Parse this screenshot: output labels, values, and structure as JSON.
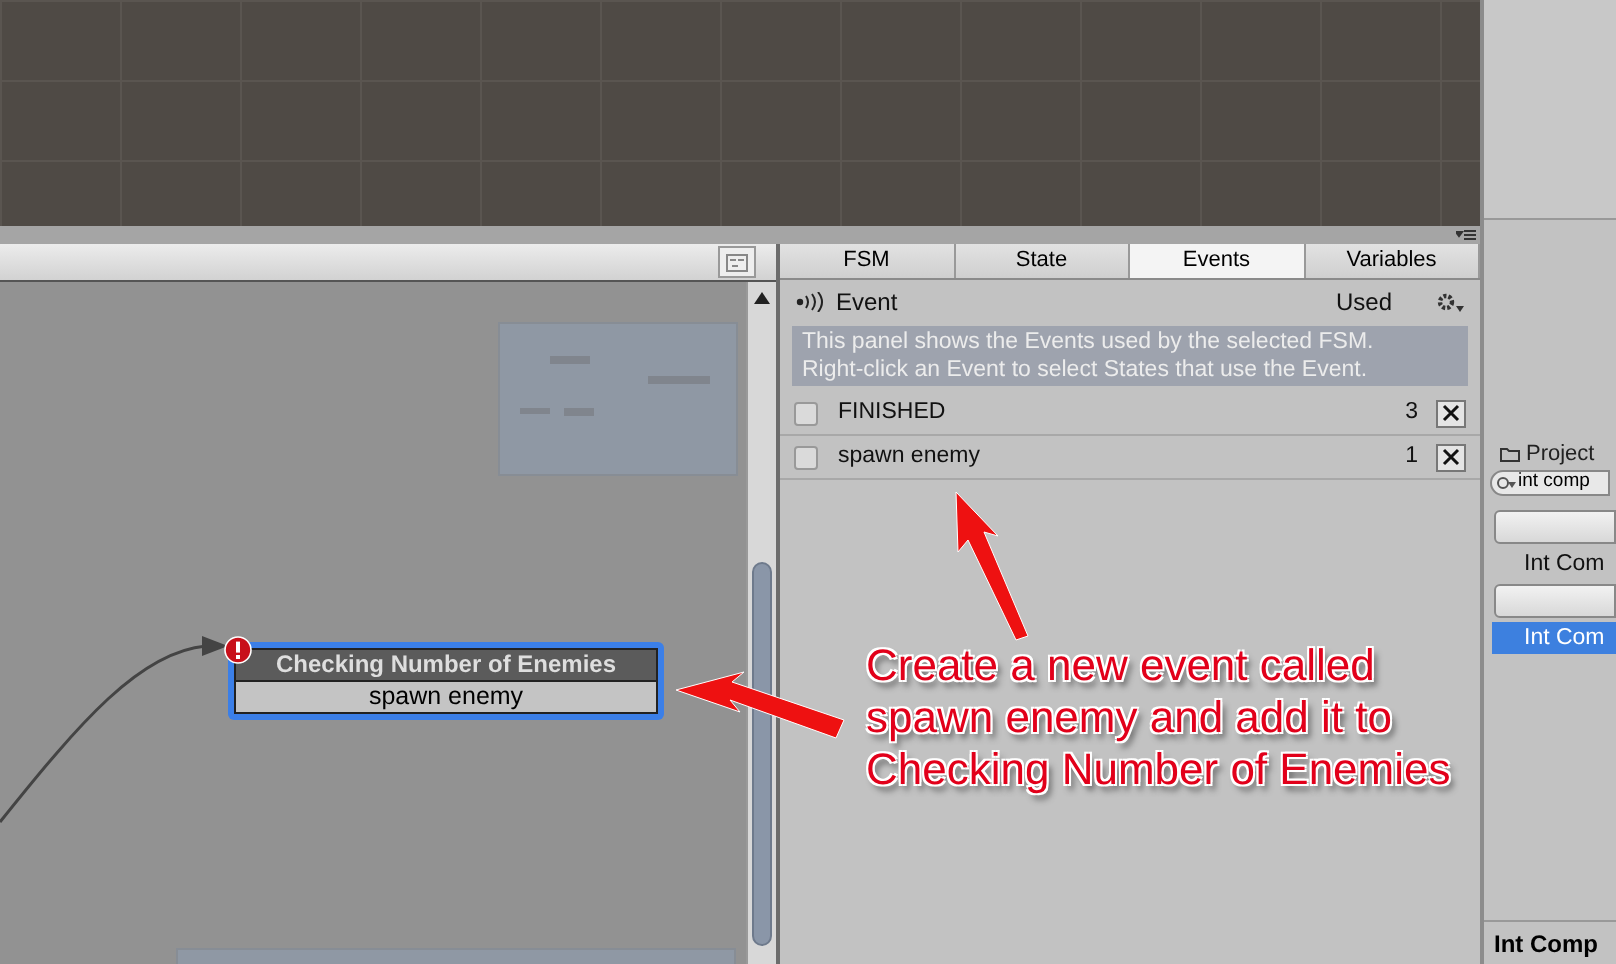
{
  "graph": {
    "node": {
      "title": "Checking Number of Enemies",
      "event": "spawn enemy",
      "selected": true,
      "error": true
    }
  },
  "fsm_panel": {
    "tabs": [
      {
        "label": "FSM",
        "selected": false
      },
      {
        "label": "State",
        "selected": false
      },
      {
        "label": "Events",
        "selected": true
      },
      {
        "label": "Variables",
        "selected": false
      }
    ],
    "header": {
      "label": "Event",
      "used": "Used"
    },
    "info": "This panel shows the Events used by the selected FSM.\nRight-click an Event to select States that use the Event.",
    "events": [
      {
        "name": "FINISHED",
        "count": "3",
        "checked": false
      },
      {
        "name": "spawn enemy",
        "count": "1",
        "checked": false
      }
    ]
  },
  "project_panel": {
    "title": "Project",
    "search": "int comp",
    "items": [
      {
        "kind": "button"
      },
      {
        "kind": "label",
        "text": "Int Com",
        "selected": false
      },
      {
        "kind": "button"
      },
      {
        "kind": "label",
        "text": "Int Com",
        "selected": true
      }
    ],
    "footer": "Int Comp"
  },
  "annotation": "Create a new event called\nspawn enemy and add it to\nChecking Number of Enemies"
}
